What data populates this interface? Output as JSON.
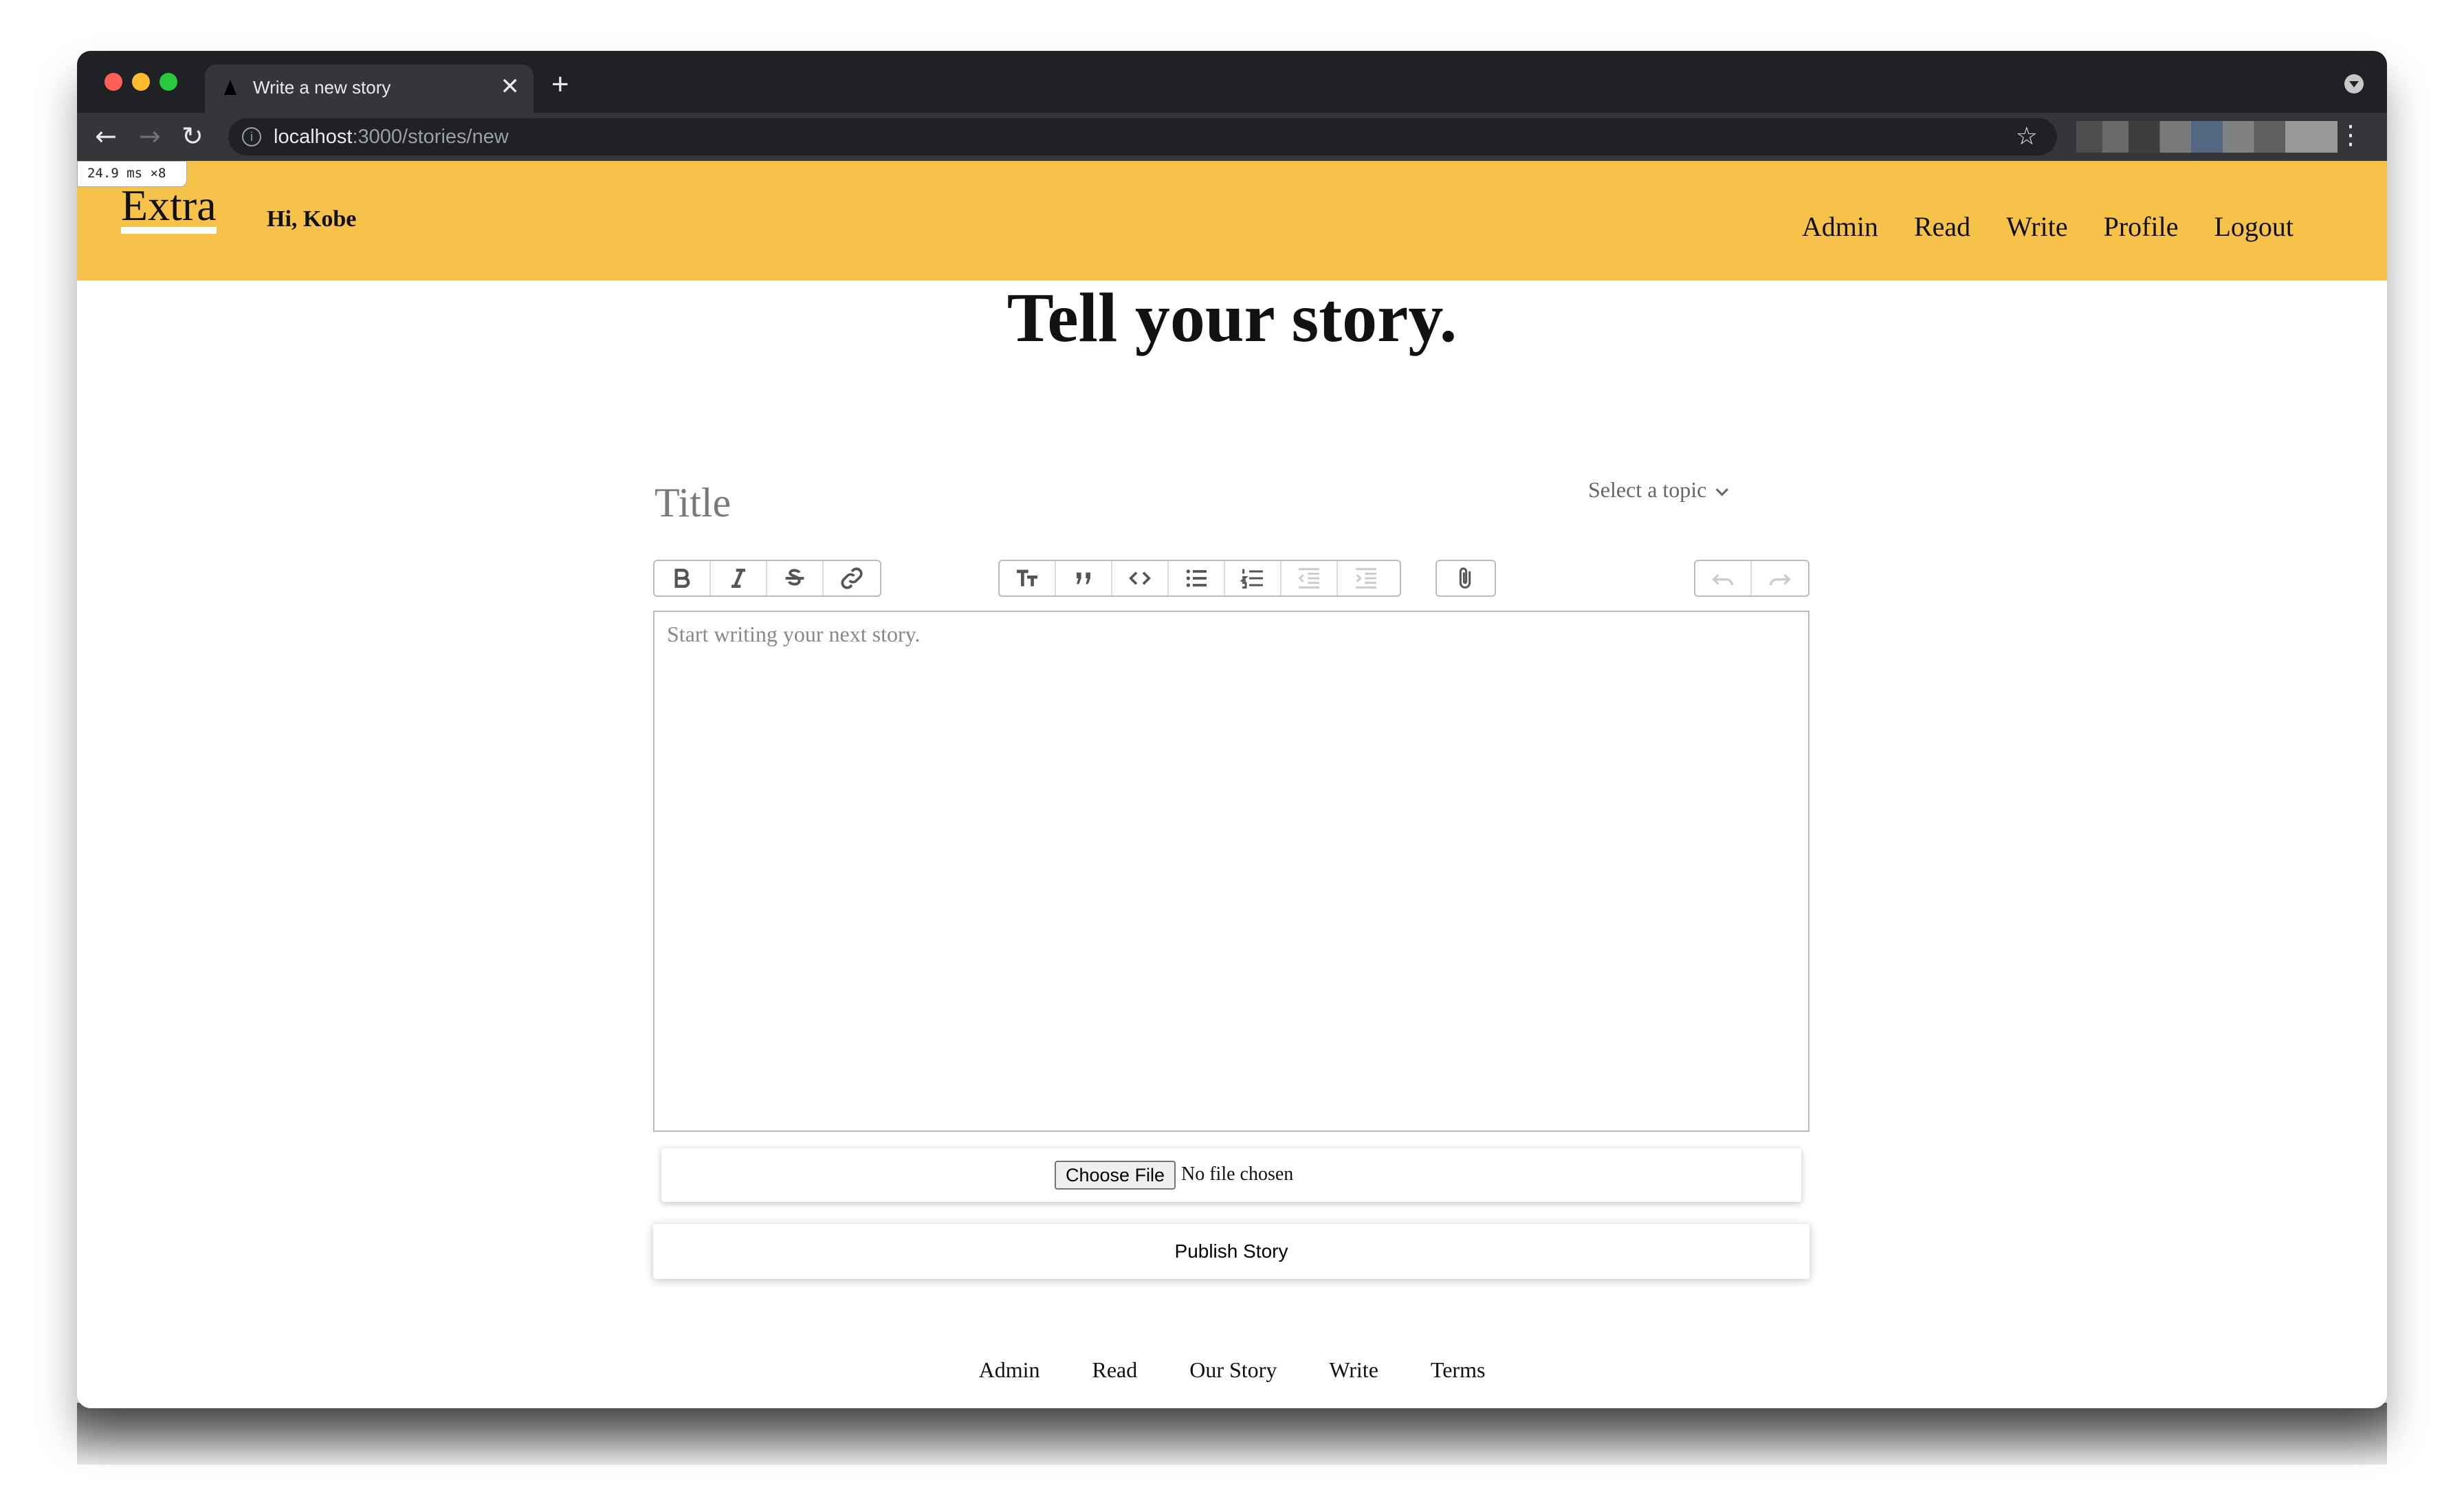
{
  "browser": {
    "tab_title": "Write a new story",
    "tab_close": "✕",
    "new_tab": "+",
    "url_host": "localhost",
    "url_path": ":3000/stories/new",
    "perf_overlay": "24.9 ms ×8",
    "traffic_colors": [
      "#ff5f57",
      "#febc2e",
      "#28c840"
    ]
  },
  "header": {
    "logo": "Extra",
    "greeting": "Hi, Kobe",
    "nav": [
      "Admin",
      "Read",
      "Write",
      "Profile",
      "Logout"
    ],
    "background": "#f6c24a"
  },
  "main": {
    "headline": "Tell your story.",
    "title_placeholder": "Title",
    "topic_select": "Select a topic",
    "editor_placeholder": "Start writing your next story.",
    "toolbar_icons": [
      "bold-icon",
      "italic-icon",
      "strikethrough-icon",
      "link-icon",
      "heading-icon",
      "quote-icon",
      "code-icon",
      "bullet-list-icon",
      "numbered-list-icon",
      "outdent-icon",
      "indent-icon",
      "attach-icon",
      "undo-icon",
      "redo-icon"
    ],
    "choose_file": "Choose File",
    "no_file": "No file chosen",
    "publish": "Publish Story"
  },
  "footer": {
    "links": [
      "Admin",
      "Read",
      "Our Story",
      "Write",
      "Terms"
    ]
  }
}
